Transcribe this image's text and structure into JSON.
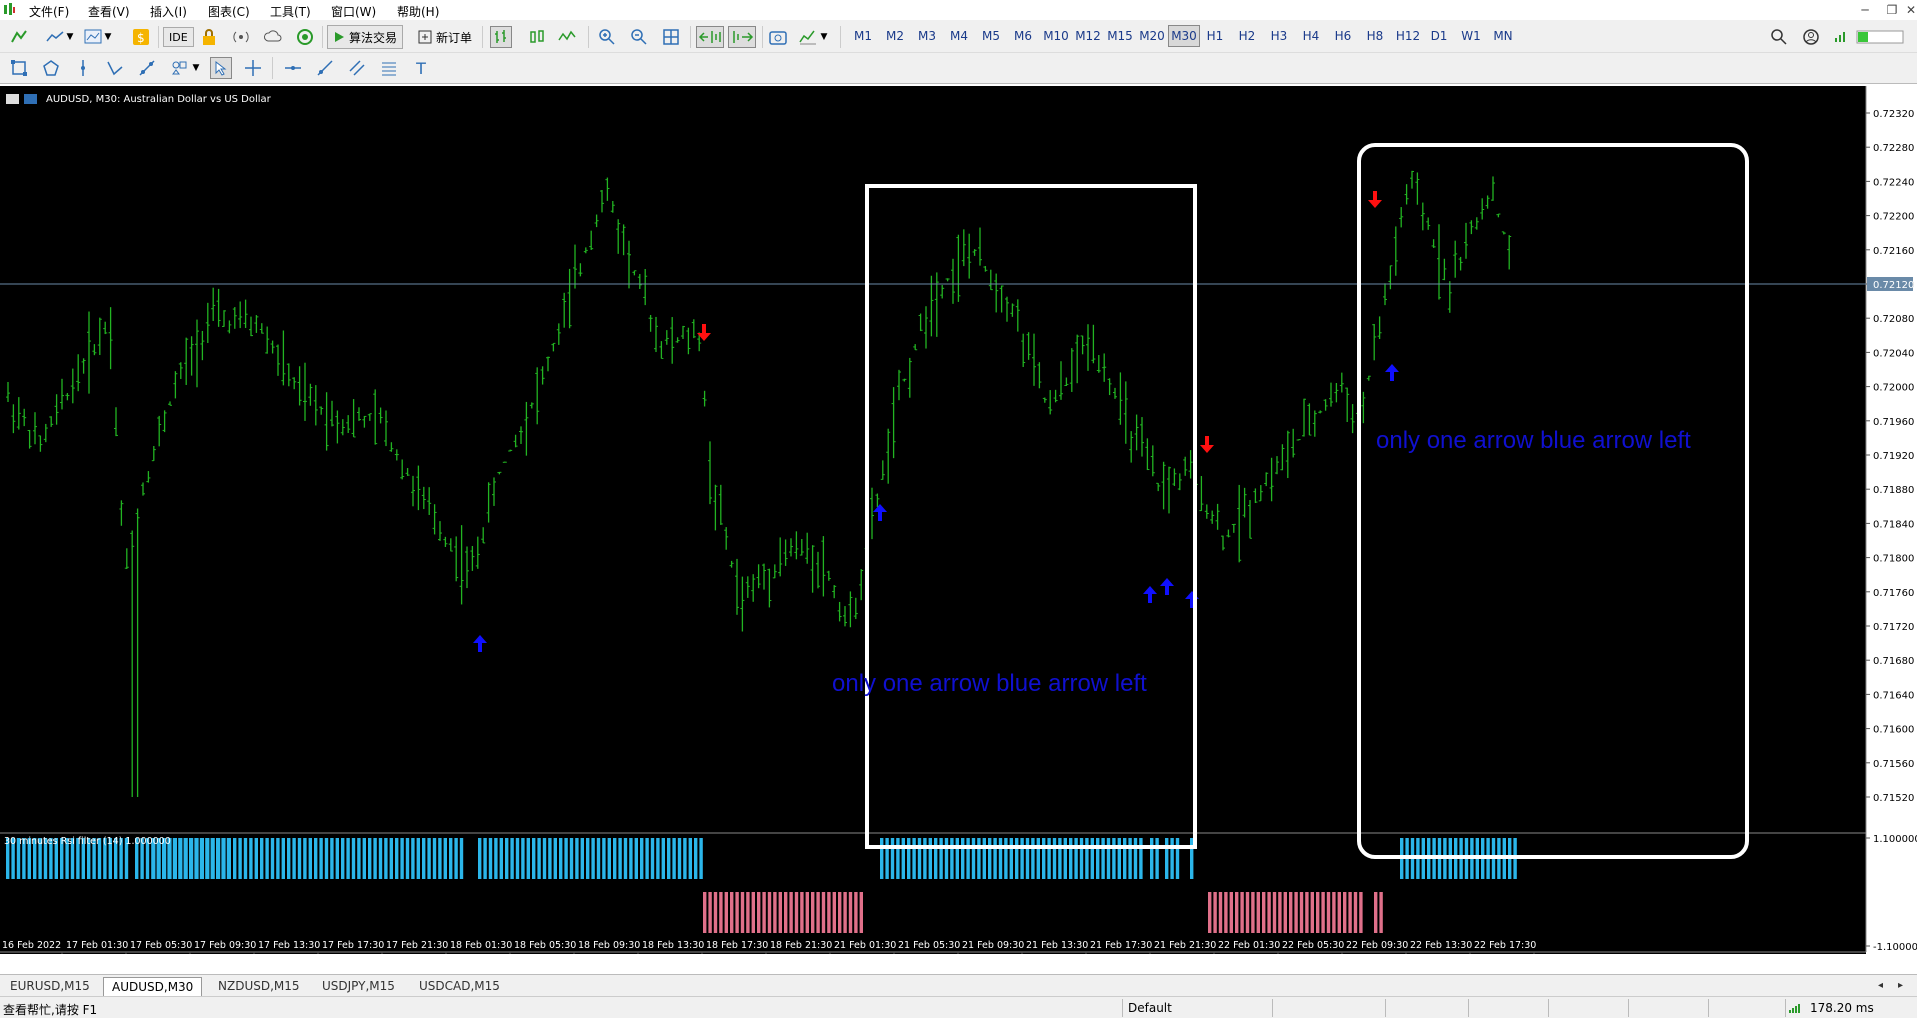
{
  "menu": [
    "文件(F)",
    "查看(V)",
    "插入(I)",
    "图表(C)",
    "工具(T)",
    "窗口(W)",
    "帮助(H)"
  ],
  "toolbar": {
    "algo_trading_label": "算法交易",
    "new_order_label": "新订单",
    "ide_label": "IDE",
    "timeframes": [
      "M1",
      "M2",
      "M3",
      "M4",
      "M5",
      "M6",
      "M10",
      "M12",
      "M15",
      "M20",
      "M30",
      "H1",
      "H2",
      "H3",
      "H4",
      "H6",
      "H8",
      "H12",
      "D1",
      "W1",
      "MN"
    ],
    "active_timeframe": "M30"
  },
  "chart": {
    "title": "AUDUSD, M30:  Australian Dollar vs US Dollar",
    "current_price": "0.72120",
    "price_axis": [
      "0.72320",
      "0.72280",
      "0.72240",
      "0.72200",
      "0.72160",
      "0.72120",
      "0.72080",
      "0.72040",
      "0.72000",
      "0.71960",
      "0.71920",
      "0.71880",
      "0.71840",
      "0.71800",
      "0.71760",
      "0.71720",
      "0.71680",
      "0.71640",
      "0.71600",
      "0.71560",
      "0.71520"
    ],
    "time_axis": [
      "16 Feb 2022",
      "17 Feb 01:30",
      "17 Feb 05:30",
      "17 Feb 09:30",
      "17 Feb 13:30",
      "17 Feb 17:30",
      "17 Feb 21:30",
      "18 Feb 01:30",
      "18 Feb 05:30",
      "18 Feb 09:30",
      "18 Feb 13:30",
      "18 Feb 17:30",
      "18 Feb 21:30",
      "21 Feb 01:30",
      "21 Feb 05:30",
      "21 Feb 09:30",
      "21 Feb 13:30",
      "21 Feb 17:30",
      "21 Feb 21:30",
      "22 Feb 01:30",
      "22 Feb 05:30",
      "22 Feb 09:30",
      "22 Feb 13:30",
      "22 Feb 17:30"
    ],
    "annotation_text": "only one arrow blue arrow left",
    "indicator_label": "30 minutes Rsi filter (14) 1.000000",
    "indicator_axis": [
      "1.100000",
      "-1.100000"
    ],
    "colors": {
      "background": "#000000",
      "bars": "#22b422",
      "up_arrow": "#1010ff",
      "down_arrow": "#ff1010",
      "rsi_up": "#2bb6ea",
      "rsi_down": "#e0708a",
      "annotation": "#1010d0",
      "price_line": "#6a8aa8"
    }
  },
  "tabs": [
    "EURUSD,M15",
    "AUDUSD,M30",
    "NZDUSD,M15",
    "USDJPY,M15",
    "USDCAD,M15"
  ],
  "active_tab": "AUDUSD,M30",
  "status": {
    "help": "查看帮忙,请按 F1",
    "profile": "Default",
    "ping": "178.20 ms"
  }
}
